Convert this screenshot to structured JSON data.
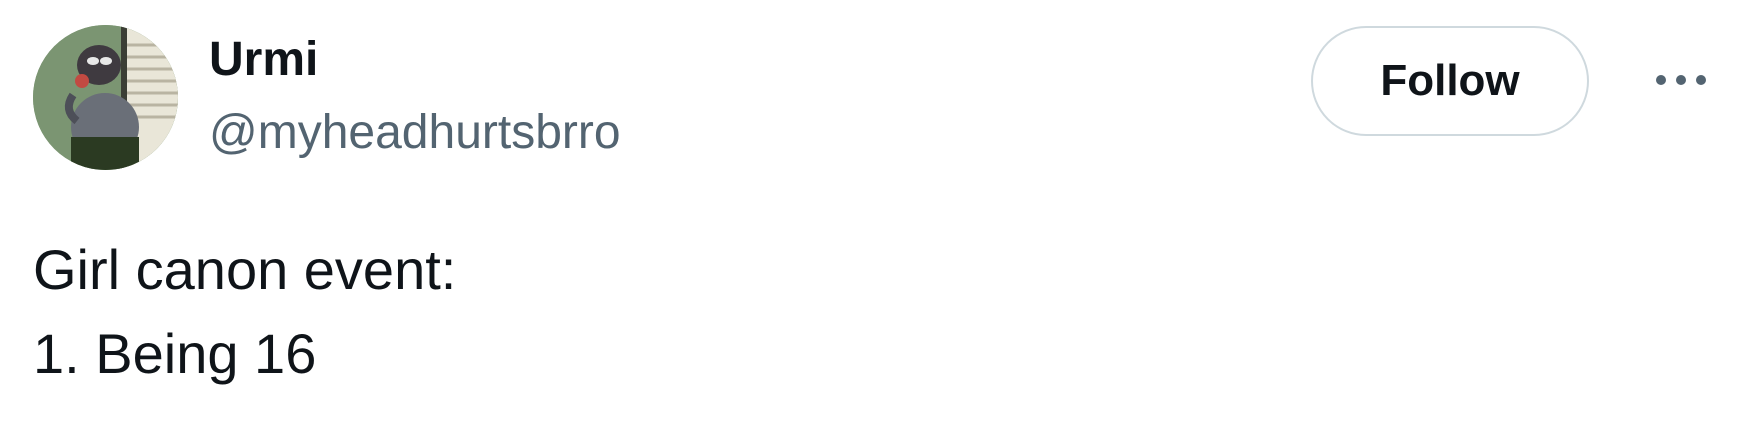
{
  "author": {
    "display_name": "Urmi",
    "handle": "@myheadhurtsbrro",
    "avatar_icon": "avatar-cartoon-character-icon"
  },
  "actions": {
    "follow_label": "Follow",
    "more_icon": "more-options-icon"
  },
  "tweet": {
    "lines": [
      "Girl canon event:",
      "1. Being 16"
    ]
  },
  "colors": {
    "text_primary": "#0f1419",
    "text_secondary": "#536471",
    "button_border": "#cfd9de"
  }
}
